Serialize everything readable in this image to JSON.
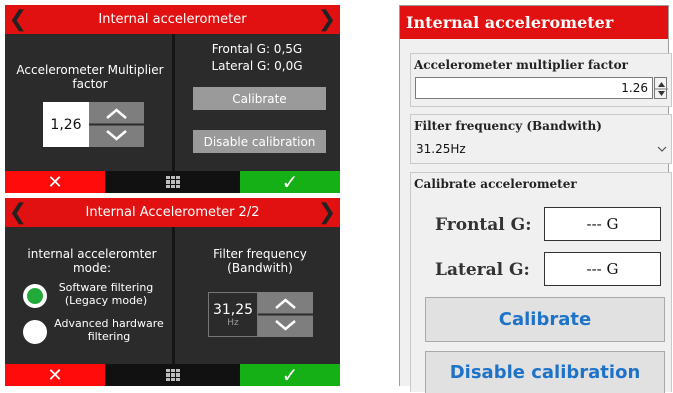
{
  "screen1": {
    "title": "Internal accelerometer",
    "multiplier_label": "Accelerometer Multiplier factor",
    "multiplier_value": "1,26",
    "frontal": "Frontal G: 0,5G",
    "lateral": "Lateral G: 0,0G",
    "calibrate_label": "Calibrate",
    "disable_label": "Disable calibration",
    "cancel_glyph": "✕",
    "ok_glyph": "✓",
    "prev_glyph": "❮",
    "next_glyph": "❯"
  },
  "screen2": {
    "title": "Internal Accelerometer 2/2",
    "mode_label": "internal acceleromter mode:",
    "option_software": "Software filtering (Legacy mode)",
    "option_hardware": "Advanced hardware filtering",
    "filter_label": "Filter frequency (Bandwith)",
    "filter_value": "31,25",
    "filter_unit": "Hz",
    "cancel_glyph": "✕",
    "ok_glyph": "✓",
    "prev_glyph": "❮",
    "next_glyph": "❯"
  },
  "dialog": {
    "title": "Internal accelerometer",
    "multiplier_label": "Accelerometer multiplier factor",
    "multiplier_value": "1.26",
    "filter_label": "Filter frequency (Bandwith)",
    "filter_value": "31.25Hz",
    "calibrate_group": "Calibrate accelerometer",
    "frontal_label": "Frontal G:",
    "frontal_value": "--- G",
    "lateral_label": "Lateral G:",
    "lateral_value": "--- G",
    "calibrate_button": "Calibrate",
    "disable_button": "Disable calibration"
  },
  "colors": {
    "title_red": "#e11111",
    "cancel_red": "#ff0b0b",
    "ok_green": "#15b015",
    "radio_green": "#1faa3a",
    "link_blue": "#1e73c8"
  }
}
